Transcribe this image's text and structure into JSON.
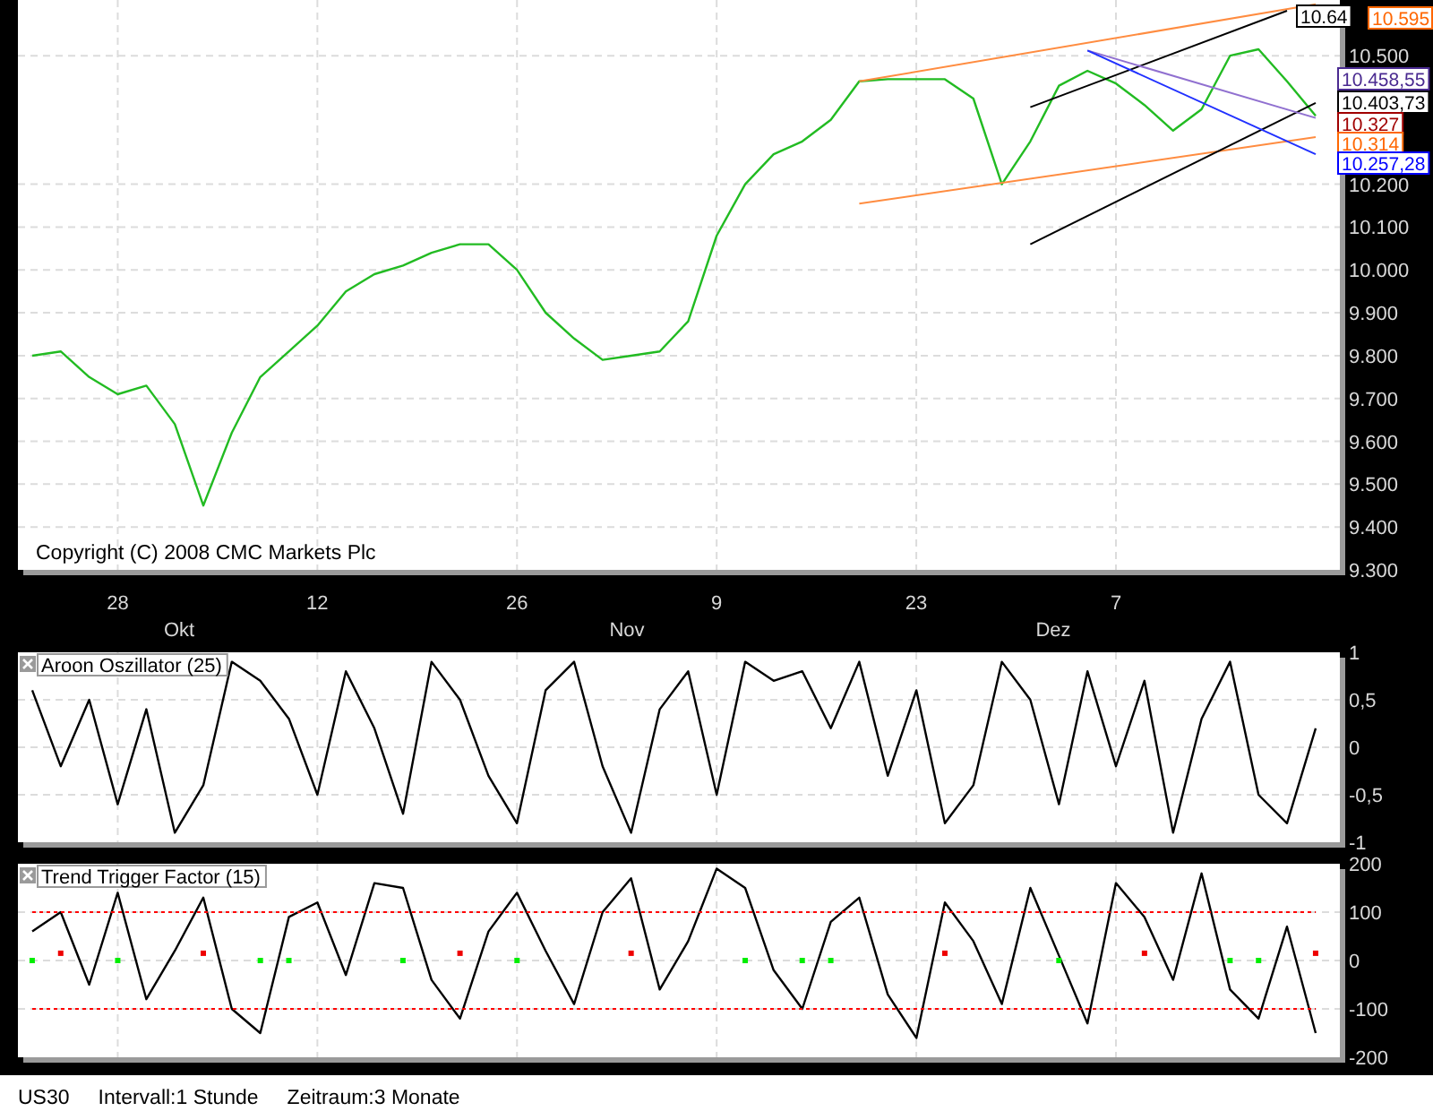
{
  "price_panel": {
    "copyright": "Copyright (C) 2008 CMC Markets Plc",
    "chart_data": {
      "type": "line",
      "categories": [
        null,
        null,
        null,
        "28",
        null,
        null,
        null,
        null,
        null,
        null,
        "12",
        null,
        null,
        null,
        null,
        null,
        null,
        "26",
        null,
        null,
        null,
        null,
        null,
        null,
        "9",
        null,
        null,
        null,
        null,
        null,
        null,
        "23",
        null,
        null,
        null,
        null,
        null,
        null,
        "7",
        null,
        null,
        null,
        null,
        null,
        null,
        null
      ],
      "series": [
        {
          "color": "#22bb22",
          "values": [
            9800,
            9810,
            9750,
            9710,
            9730,
            9640,
            9450,
            9620,
            9750,
            9810,
            9870,
            9950,
            9990,
            10010,
            10040,
            10060,
            10060,
            10000,
            9900,
            9840,
            9790,
            9800,
            9810,
            9880,
            10080,
            10200,
            10270,
            10300,
            10350,
            10440,
            10445,
            10445,
            10445,
            10400,
            10200,
            10300,
            10430,
            10465,
            10435,
            10385,
            10325,
            10375,
            10500,
            10515,
            10440,
            10360
          ]
        },
        {
          "color": "#ff8c40",
          "values": [
            null,
            null,
            null,
            null,
            null,
            null,
            null,
            null,
            null,
            null,
            null,
            null,
            null,
            null,
            null,
            null,
            null,
            null,
            null,
            null,
            null,
            null,
            null,
            null,
            null,
            null,
            null,
            null,
            null,
            10440,
            null,
            null,
            null,
            null,
            null,
            null,
            null,
            null,
            null,
            null,
            null,
            null,
            null,
            null,
            null,
            10620
          ]
        },
        {
          "color": "#ff8c40",
          "values": [
            null,
            null,
            null,
            null,
            null,
            null,
            null,
            null,
            null,
            null,
            null,
            null,
            null,
            null,
            null,
            null,
            null,
            null,
            null,
            null,
            null,
            null,
            null,
            null,
            null,
            null,
            null,
            null,
            null,
            10155,
            null,
            null,
            null,
            null,
            null,
            null,
            null,
            null,
            null,
            null,
            null,
            null,
            null,
            null,
            null,
            10310
          ]
        },
        {
          "color": "#000000",
          "values": [
            null,
            null,
            null,
            null,
            null,
            null,
            null,
            null,
            null,
            null,
            null,
            null,
            null,
            null,
            null,
            null,
            null,
            null,
            null,
            null,
            null,
            null,
            null,
            null,
            null,
            null,
            null,
            null,
            null,
            null,
            null,
            null,
            null,
            null,
            null,
            10380,
            null,
            null,
            null,
            null,
            null,
            null,
            null,
            null,
            10605,
            null
          ]
        },
        {
          "color": "#000000",
          "values": [
            null,
            null,
            null,
            null,
            null,
            null,
            null,
            null,
            null,
            null,
            null,
            null,
            null,
            null,
            null,
            null,
            null,
            null,
            null,
            null,
            null,
            null,
            null,
            null,
            null,
            null,
            null,
            null,
            null,
            null,
            null,
            null,
            null,
            null,
            null,
            10060,
            null,
            null,
            null,
            null,
            null,
            null,
            null,
            null,
            null,
            10390
          ]
        },
        {
          "color": "#9070d0",
          "values": [
            null,
            null,
            null,
            null,
            null,
            null,
            null,
            null,
            null,
            null,
            null,
            null,
            null,
            null,
            null,
            null,
            null,
            null,
            null,
            null,
            null,
            null,
            null,
            null,
            null,
            null,
            null,
            null,
            null,
            null,
            null,
            null,
            null,
            null,
            null,
            null,
            null,
            10512,
            null,
            null,
            null,
            null,
            null,
            null,
            null,
            10355
          ]
        },
        {
          "color": "#2030ff",
          "values": [
            null,
            null,
            null,
            null,
            null,
            null,
            null,
            null,
            null,
            null,
            null,
            null,
            null,
            null,
            null,
            null,
            null,
            null,
            null,
            null,
            null,
            null,
            null,
            null,
            null,
            null,
            null,
            null,
            null,
            null,
            null,
            null,
            null,
            null,
            null,
            null,
            null,
            10512,
            null,
            null,
            null,
            null,
            null,
            null,
            null,
            10270
          ]
        }
      ],
      "ylim": [
        9300,
        10630
      ],
      "grid": true,
      "yticks": [
        {
          "value": 9300,
          "label": "9.300"
        },
        {
          "value": 9400,
          "label": "9.400"
        },
        {
          "value": 9500,
          "label": "9.500"
        },
        {
          "value": 9600,
          "label": "9.600"
        },
        {
          "value": 9700,
          "label": "9.700"
        },
        {
          "value": 9800,
          "label": "9.800"
        },
        {
          "value": 9900,
          "label": "9.900"
        },
        {
          "value": 10000,
          "label": "10.000"
        },
        {
          "value": 10100,
          "label": "10.100"
        },
        {
          "value": 10200,
          "label": "10.200"
        },
        {
          "value": 10500,
          "label": "10.500"
        }
      ]
    },
    "month_labels": [
      "Okt",
      "Nov",
      "Dez"
    ],
    "price_tags": [
      {
        "label": "10.64",
        "color": "#000000"
      },
      {
        "label": "10.595",
        "color": "#ff6600"
      },
      {
        "label": "10.458,55",
        "color": "#4a2a90"
      },
      {
        "label": "10.403,73",
        "color": "#000000"
      },
      {
        "label": "10.327",
        "color": "#a00000"
      },
      {
        "label": "10.314",
        "color": "#ff6600"
      },
      {
        "label": "10.257,28",
        "color": "#0000ff"
      }
    ]
  },
  "aroon_panel": {
    "chart_data": {
      "type": "line",
      "title": "Aroon Oszillator (25)",
      "series": [
        {
          "color": "#000000",
          "values": [
            0.6,
            -0.2,
            0.5,
            -0.6,
            0.4,
            -0.9,
            -0.4,
            0.9,
            0.7,
            0.3,
            -0.5,
            0.8,
            0.2,
            -0.7,
            0.9,
            0.5,
            -0.3,
            -0.8,
            0.6,
            0.9,
            -0.2,
            -0.9,
            0.4,
            0.8,
            -0.5,
            0.9,
            0.7,
            0.8,
            0.2,
            0.9,
            -0.3,
            0.6,
            -0.8,
            -0.4,
            0.9,
            0.5,
            -0.6,
            0.8,
            -0.2,
            0.7,
            -0.9,
            0.3,
            0.9,
            -0.5,
            -0.8,
            0.2
          ]
        }
      ],
      "ylim": [
        -1,
        1
      ],
      "grid": true,
      "yticks": [
        {
          "value": 1,
          "label": "1"
        },
        {
          "value": 0.5,
          "label": "0,5"
        },
        {
          "value": 0,
          "label": "0"
        },
        {
          "value": -0.5,
          "label": "-0,5"
        },
        {
          "value": -1,
          "label": "-1"
        }
      ]
    }
  },
  "ttf_panel": {
    "chart_data": {
      "type": "line",
      "title": "Trend Trigger Factor (15)",
      "series": [
        {
          "color": "#000000",
          "values": [
            60,
            100,
            -50,
            140,
            -80,
            20,
            130,
            -100,
            -150,
            90,
            120,
            -30,
            160,
            150,
            -40,
            -120,
            60,
            140,
            20,
            -90,
            100,
            170,
            -60,
            40,
            190,
            150,
            -20,
            -100,
            80,
            130,
            -70,
            -160,
            120,
            40,
            -90,
            150,
            10,
            -130,
            160,
            90,
            -40,
            180,
            -60,
            -120,
            70,
            -150
          ]
        },
        {
          "color": "#ff0000",
          "line_style": "dashed",
          "values": [
            100,
            100,
            100,
            100,
            100,
            100,
            100,
            100,
            100,
            100,
            100,
            100,
            100,
            100,
            100,
            100,
            100,
            100,
            100,
            100,
            100,
            100,
            100,
            100,
            100,
            100,
            100,
            100,
            100,
            100,
            100,
            100,
            100,
            100,
            100,
            100,
            100,
            100,
            100,
            100,
            100,
            100,
            100,
            100,
            100,
            100
          ]
        },
        {
          "color": "#ff0000",
          "line_style": "dashed",
          "values": [
            -100,
            -100,
            -100,
            -100,
            -100,
            -100,
            -100,
            -100,
            -100,
            -100,
            -100,
            -100,
            -100,
            -100,
            -100,
            -100,
            -100,
            -100,
            -100,
            -100,
            -100,
            -100,
            -100,
            -100,
            -100,
            -100,
            -100,
            -100,
            -100,
            -100,
            -100,
            -100,
            -100,
            -100,
            -100,
            -100,
            -100,
            -100,
            -100,
            -100,
            -100,
            -100,
            -100,
            -100,
            -100,
            -100
          ]
        },
        {
          "type": "scatter",
          "color": "#00ee00",
          "values": [
            0,
            null,
            null,
            0,
            null,
            null,
            null,
            null,
            0,
            0,
            null,
            null,
            null,
            0,
            null,
            null,
            null,
            0,
            null,
            null,
            null,
            null,
            null,
            null,
            null,
            0,
            null,
            0,
            0,
            null,
            null,
            null,
            null,
            null,
            null,
            null,
            0,
            null,
            null,
            null,
            null,
            null,
            0,
            0,
            null,
            null
          ]
        },
        {
          "type": "scatter",
          "color": "#ee0000",
          "values": [
            null,
            15,
            null,
            null,
            null,
            null,
            15,
            null,
            null,
            null,
            null,
            null,
            null,
            null,
            null,
            15,
            null,
            null,
            null,
            null,
            null,
            15,
            null,
            null,
            null,
            null,
            null,
            null,
            null,
            null,
            null,
            null,
            15,
            null,
            null,
            null,
            null,
            null,
            null,
            15,
            null,
            null,
            null,
            null,
            null,
            15
          ]
        }
      ],
      "ylim": [
        -200,
        200
      ],
      "grid": true,
      "yticks": [
        {
          "value": 200,
          "label": "200"
        },
        {
          "value": 100,
          "label": "100"
        },
        {
          "value": 0,
          "label": "0"
        },
        {
          "value": -100,
          "label": "-100"
        },
        {
          "value": -200,
          "label": "-200"
        }
      ]
    }
  },
  "status_bar": {
    "symbol": "US30",
    "interval": "Intervall:1 Stunde",
    "period": "Zeitraum:3 Monate"
  }
}
